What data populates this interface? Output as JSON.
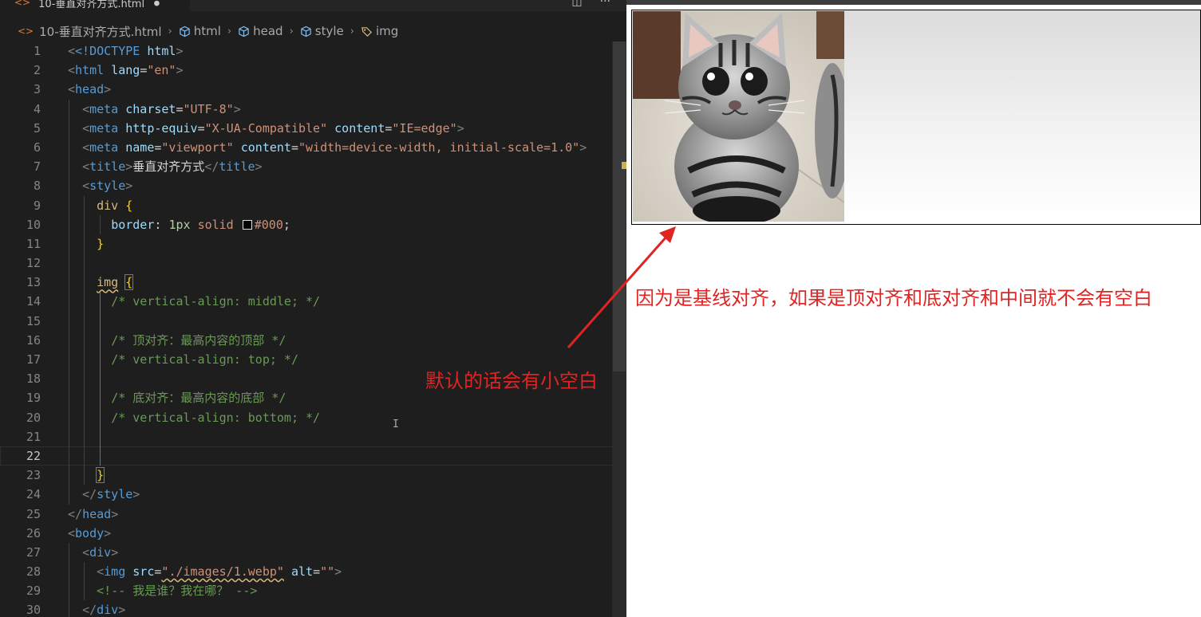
{
  "tab": {
    "title": "10-垂直对齐方式.html",
    "dirty": "●"
  },
  "editor_actions": {
    "split": "◫",
    "more": "···"
  },
  "breadcrumb": [
    "10-垂直对齐方式.html",
    "html",
    "head",
    "style",
    "img"
  ],
  "code": {
    "lines": [
      "1",
      "2",
      "3",
      "4",
      "5",
      "6",
      "7",
      "8",
      "9",
      "10",
      "11",
      "12",
      "13",
      "14",
      "15",
      "16",
      "17",
      "18",
      "19",
      "20",
      "21",
      "22",
      "23",
      "24",
      "25",
      "26",
      "27",
      "28",
      "29",
      "30"
    ],
    "current_line": "22",
    "line_texts": {
      "l1_doctype": "<!DOCTYPE",
      "l1_html": "html",
      "l2_tag": "html",
      "l2_attr": "lang",
      "l2_val": "\"en\"",
      "l3_tag": "head",
      "l4_tag": "meta",
      "l4_attr": "charset",
      "l4_val": "\"UTF-8\"",
      "l5_tag": "meta",
      "l5_attr1": "http-equiv",
      "l5_val1": "\"X-UA-Compatible\"",
      "l5_attr2": "content",
      "l5_val2": "\"IE=edge\"",
      "l6_tag": "meta",
      "l6_attr1": "name",
      "l6_val1": "\"viewport\"",
      "l6_attr2": "content",
      "l6_val2": "\"width=device-width, initial-scale=1.0\"",
      "l7_tag": "title",
      "l7_text": "垂直对齐方式",
      "l8_tag": "style",
      "l9_sel": "div",
      "l10_prop": "border",
      "l10_num": "1px",
      "l10_val": "solid",
      "l10_color": "#000",
      "l13_sel": "img",
      "l14": "/* vertical-align: middle; */",
      "l16": "/* 顶对齐：最高内容的顶部 */",
      "l17": "/* vertical-align: top; */",
      "l19": "/* 底对齐：最高内容的底部 */",
      "l20": "/* vertical-align: bottom; */",
      "l24_tag": "style",
      "l25_tag": "head",
      "l26_tag": "body",
      "l27_tag": "div",
      "l28_tag": "img",
      "l28_attr1": "src",
      "l28_val1": "\"./images/1.webp\"",
      "l28_attr2": "alt",
      "l28_val2": "\"\"",
      "l29": "<!-- 我是谁？我在哪？ -->",
      "l30_tag": "div"
    }
  },
  "annotations": {
    "note_top": "因为是基线对齐，如果是顶对齐和底对齐和中间就不会有空白",
    "note_arrow": "默认的话会有小空白",
    "color": "#e02424"
  },
  "preview": {
    "image": "kitten photo",
    "border_color": "#000"
  }
}
